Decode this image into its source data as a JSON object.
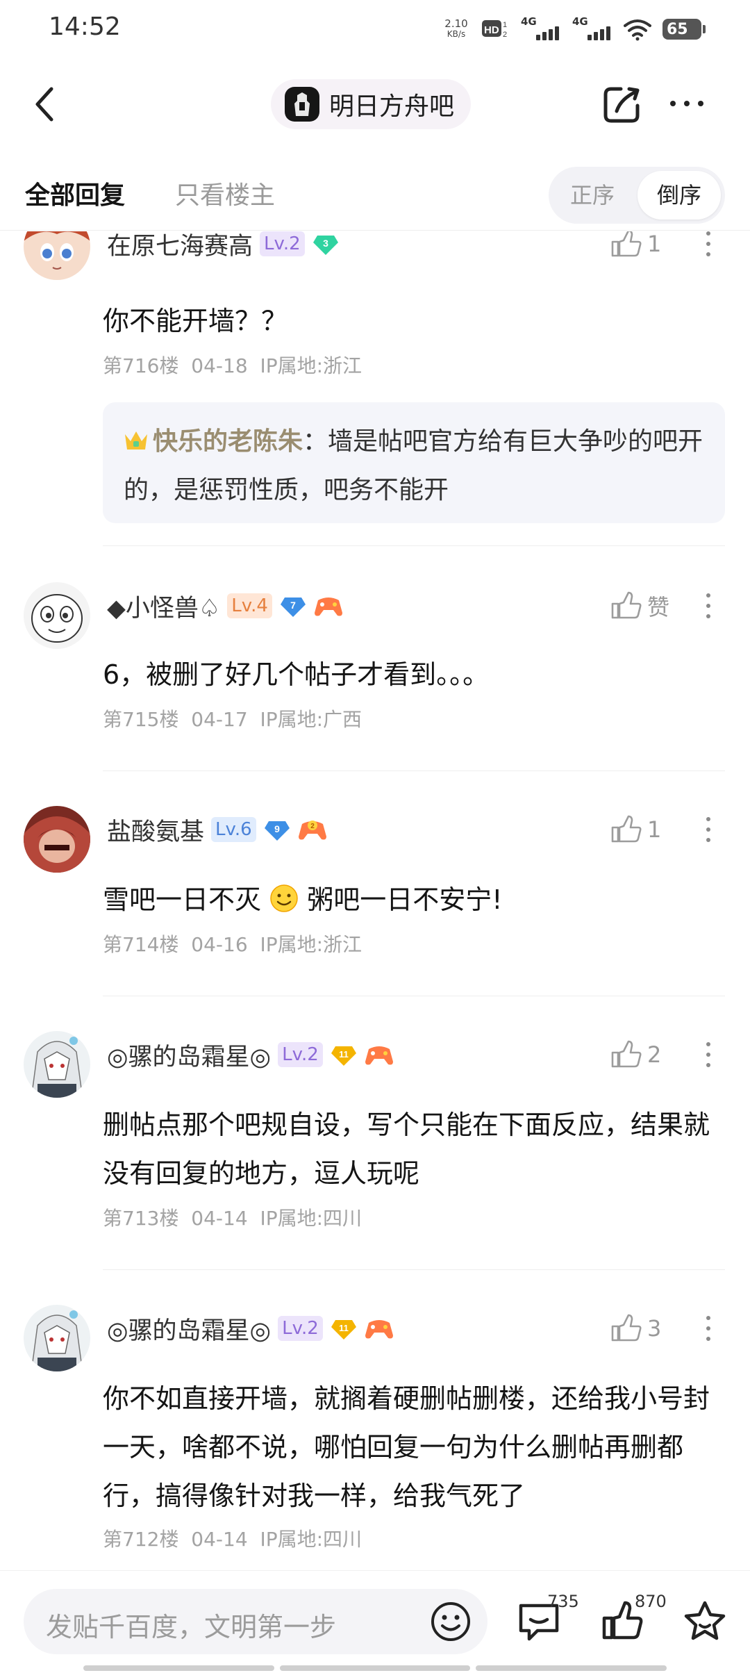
{
  "status_bar": {
    "time": "14:52",
    "net_speed_value": "2.10",
    "net_speed_unit": "KB/s",
    "hd_label": "HD",
    "sim1_label": "4G",
    "sim2_label": "4G",
    "battery": "65"
  },
  "nav": {
    "forum_name": "明日方舟吧"
  },
  "tabs": {
    "all": "全部回复",
    "host_only": "只看楼主",
    "order_asc": "正序",
    "order_desc": "倒序"
  },
  "replies": [
    {
      "username": "在原七海赛高",
      "level": "Lv.2",
      "gem_level": "3",
      "likes": "1",
      "content": "你不能开墙？？",
      "floor": "第716楼",
      "date": "04-18",
      "ip": "IP属地:浙江",
      "sub_reply": {
        "author": "快乐的老陈朱",
        "text": "：墙是帖吧官方给有巨大争吵的吧开的，是惩罚性质，吧务不能开"
      }
    },
    {
      "username": "◆小怪兽♤",
      "level": "Lv.4",
      "gem_level": "7",
      "likes": "赞",
      "content": "6，被删了好几个帖子才看到。。。",
      "floor": "第715楼",
      "date": "04-17",
      "ip": "IP属地:广西"
    },
    {
      "username": "盐酸氨基",
      "level": "Lv.6",
      "gem_level": "9",
      "game_level": "2",
      "likes": "1",
      "content_before": "雪吧一日不灭",
      "content_after": "粥吧一日不安宁!",
      "floor": "第714楼",
      "date": "04-16",
      "ip": "IP属地:浙江"
    },
    {
      "username": "◎骡的岛霜星◎",
      "level": "Lv.2",
      "gem_level": "11",
      "likes": "2",
      "content": "删帖点那个吧规自设，写个只能在下面反应，结果就没有回复的地方，逗人玩呢",
      "floor": "第713楼",
      "date": "04-14",
      "ip": "IP属地:四川"
    },
    {
      "username": "◎骡的岛霜星◎",
      "level": "Lv.2",
      "gem_level": "11",
      "likes": "3",
      "content": "你不如直接开墙，就搁着硬删帖删楼，还给我小号封一天，啥都不说，哪怕回复一句为什么删帖再删都行，搞得像针对我一样，给我气死了",
      "floor": "第712楼",
      "date": "04-14",
      "ip": "IP属地:四川"
    }
  ],
  "bottom_bar": {
    "placeholder": "发贴千百度，文明第一步",
    "comment_count": "735",
    "like_count": "870"
  },
  "colors": {
    "accent_purple": "#8d6ad8",
    "gem_green": "#2fd3a0",
    "gem_blue": "#3d8fe6",
    "gem_gold": "#f4b400",
    "game_orange": "#ff7a45"
  }
}
